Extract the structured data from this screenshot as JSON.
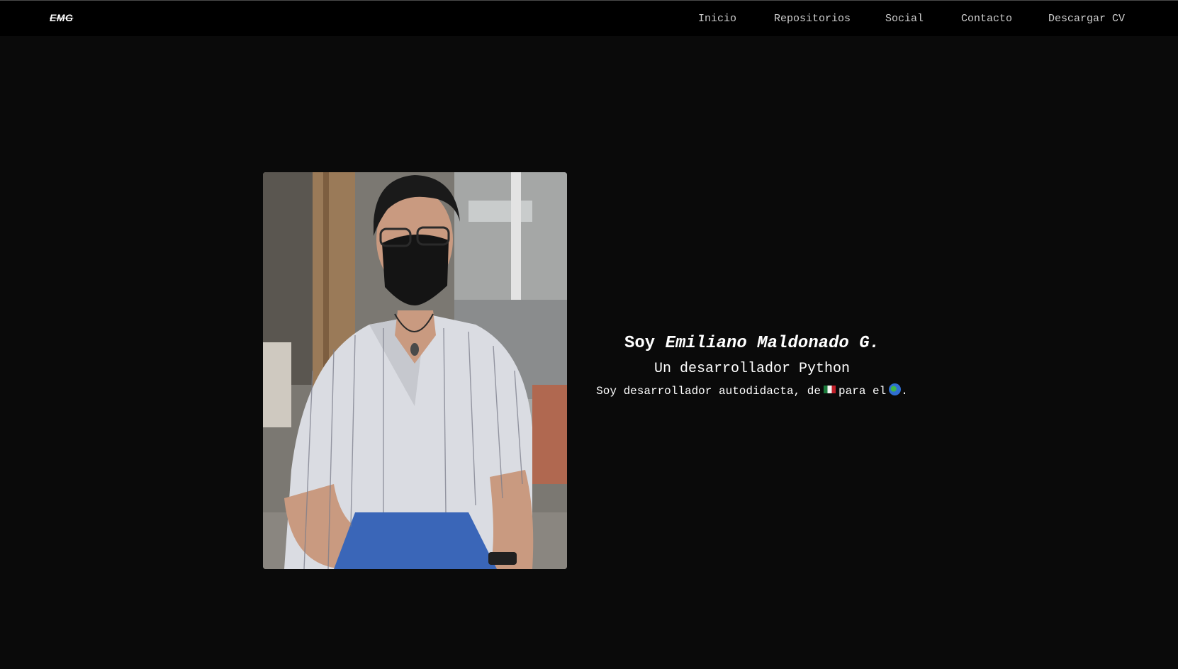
{
  "brand": {
    "logo_text": "EMG"
  },
  "nav": {
    "items": [
      {
        "label": "Inicio"
      },
      {
        "label": "Repositorios"
      },
      {
        "label": "Social"
      },
      {
        "label": "Contacto"
      },
      {
        "label": "Descargar CV"
      }
    ]
  },
  "hero": {
    "title_prefix": "Soy",
    "title_name": "Emiliano Maldonado G.",
    "subtitle": "Un desarrollador Python",
    "description_part1": "Soy desarrollador autodidacta, de",
    "flag_icon": "mexico-flag-icon",
    "description_part2": "para el",
    "globe_icon": "globe-americas-icon",
    "description_part3": ".",
    "photo_icon": "profile-photo"
  },
  "colors": {
    "background": "#0a0a0a",
    "navbar": "#000000",
    "nav_text": "#cfcfcf",
    "text": "#ffffff"
  }
}
